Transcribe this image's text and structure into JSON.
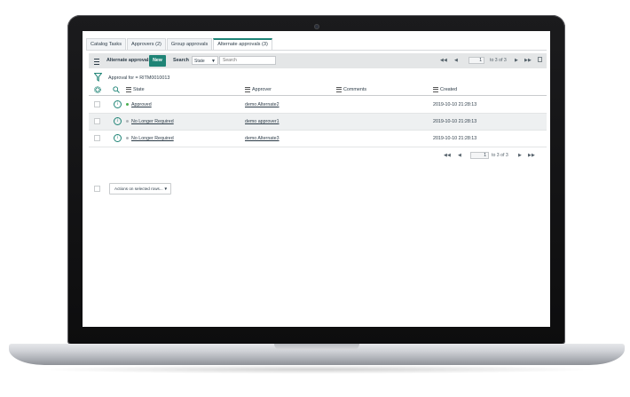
{
  "tabs": [
    {
      "label": "Catalog Tasks",
      "active": false
    },
    {
      "label": "Approvers (2)",
      "active": false
    },
    {
      "label": "Group approvals",
      "active": false
    },
    {
      "label": "Alternate approvals (3)",
      "active": true
    }
  ],
  "toolbar": {
    "list_title": "Alternate approvals",
    "new_label": "New",
    "search_label": "Search",
    "search_field_value": "State",
    "search_placeholder": "Search",
    "page_value": "1",
    "page_range": "to 3 of 3"
  },
  "breadcrumb": "Approval for = RITM0010013",
  "columns": {
    "state": "State",
    "approver": "Approver",
    "comments": "Comments",
    "created": "Created"
  },
  "rows": [
    {
      "state": "Approved",
      "state_color": "#4bae4f",
      "approver": "demo Alternate2",
      "comments": "",
      "created": "2019-10-10 21:28:13"
    },
    {
      "state": "No Longer Required",
      "state_color": "#b0b5b9",
      "approver": "demo approver1",
      "comments": "",
      "created": "2019-10-10 21:28:13"
    },
    {
      "state": "No Longer Required",
      "state_color": "#b0b5b9",
      "approver": "demo Alternate3",
      "comments": "",
      "created": "2019-10-10 21:28:13"
    }
  ],
  "footer": {
    "actions_label": "Actions on selected rows...",
    "page_value": "1",
    "page_range": "to 3 of 3"
  },
  "colors": {
    "accent": "#1f8476",
    "toolbar_bg": "#e4e6e7"
  }
}
